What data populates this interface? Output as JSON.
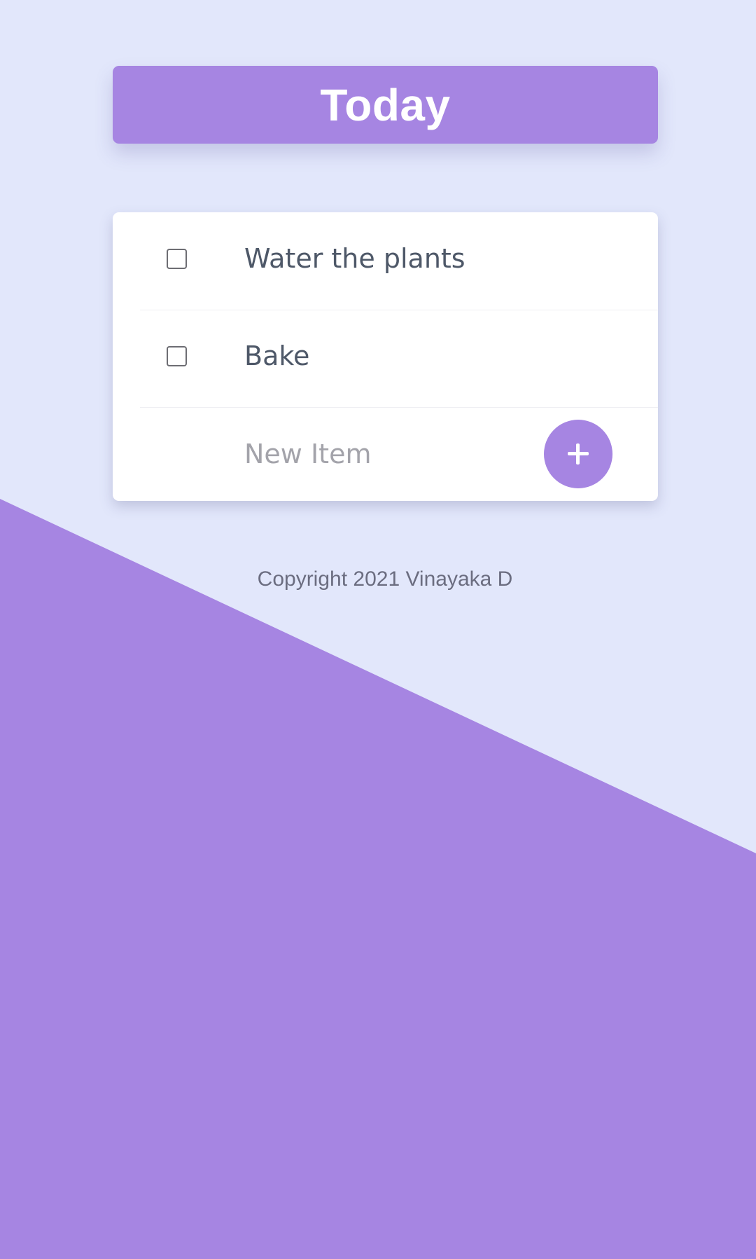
{
  "header": {
    "title": "Today"
  },
  "list": {
    "items": [
      {
        "label": "Water the plants",
        "checked": false
      },
      {
        "label": "Bake",
        "checked": false
      }
    ]
  },
  "new_item": {
    "placeholder": "New Item",
    "value": "",
    "add_icon": "plus-icon"
  },
  "footer": {
    "text": "Copyright 2021 Vinayaka D"
  },
  "colors": {
    "background": "#e2e7fb",
    "accent": "#a685e2",
    "card": "#ffffff",
    "text": "#3f4a5c",
    "footer_text": "#6b6d80"
  }
}
